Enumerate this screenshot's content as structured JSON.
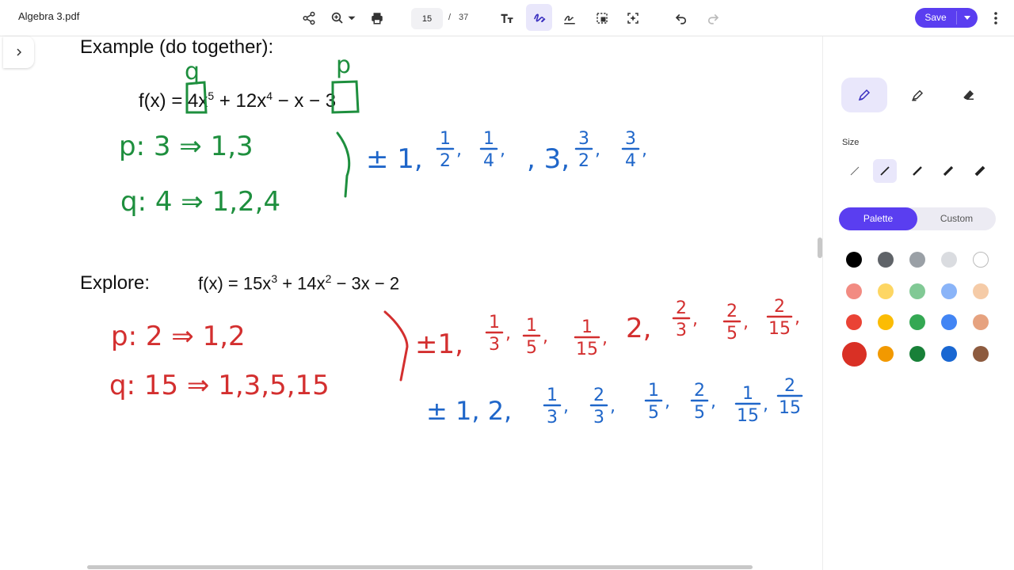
{
  "app": {
    "file_name": "Algebra 3.pdf",
    "page_current": "15",
    "page_separator": "/",
    "page_total": "37",
    "save_label": "Save"
  },
  "toolbar_icons": [
    "share-icon",
    "zoom-in-icon",
    "zoom-caret-icon",
    "print-icon",
    "text-tool-icon",
    "draw-tool-icon",
    "sign-icon",
    "select-area-icon",
    "ai-assist-icon",
    "undo-icon",
    "redo-icon",
    "more-icon"
  ],
  "document": {
    "example_heading": "Example (do together):",
    "example_eq": {
      "prefix": "f(x) =",
      "c1": "4",
      "t1": "x",
      "e1": "5",
      "mid": " + 12x",
      "e2": "4",
      "suffix": " − x − ",
      "c_last": "3"
    },
    "explore_heading": "Explore:",
    "explore_eq": {
      "prefix": "f(x) = 15x",
      "e1": "3",
      "mid": " + 14x",
      "e2": "2",
      "suffix": " − 3x − 2"
    },
    "ink": {
      "q_label": "q",
      "p_label": "p",
      "p_line_1": "p: 3 ⇒ 1,3",
      "q_line_1": "q: 4 ⇒ 1,2,4",
      "list_1": "± 1,",
      "list_1_end": ", 3,",
      "frac_1": [
        {
          "n": "1",
          "d": "2"
        },
        {
          "n": "1",
          "d": "4"
        }
      ],
      "frac_1b": [
        {
          "n": "3",
          "d": "2"
        },
        {
          "n": "3",
          "d": "4"
        }
      ],
      "p_line_2": "p: 2 ⇒ 1,2",
      "q_line_2": "q: 15 ⇒ 1,3,5,15",
      "list_2": "±1,",
      "list_2_mid": "2,",
      "frac_2": [
        {
          "n": "1",
          "d": "3"
        },
        {
          "n": "1",
          "d": "5"
        },
        {
          "n": "1",
          "d": "15"
        }
      ],
      "frac_2b": [
        {
          "n": "2",
          "d": "3"
        },
        {
          "n": "2",
          "d": "5"
        },
        {
          "n": "2",
          "d": "15"
        }
      ],
      "list_3": "± 1, 2,",
      "frac_3": [
        {
          "n": "1",
          "d": "3"
        },
        {
          "n": "2",
          "d": "3"
        },
        {
          "n": "1",
          "d": "5"
        },
        {
          "n": "2",
          "d": "5"
        },
        {
          "n": "1",
          "d": "15"
        },
        {
          "n": "2",
          "d": "15"
        }
      ]
    }
  },
  "panel": {
    "size_label": "Size",
    "palette_tab": "Palette",
    "custom_tab": "Custom",
    "colors": {
      "green_ink": "#1e8f3e",
      "blue_ink": "#1f66c9",
      "red_ink": "#d32f2f",
      "accent": "#5a3ef0"
    },
    "swatches": [
      [
        "#000000",
        "#5f6368",
        "#9aa0a6",
        "#dadce0",
        "#ffffff"
      ],
      [
        "#f28b82",
        "#fdd663",
        "#81c995",
        "#8ab4f8",
        "#f5cba7"
      ],
      [
        "#ea4335",
        "#fbbc04",
        "#34a853",
        "#4285f4",
        "#e6a27f"
      ],
      [
        "#d93025",
        "#f29900",
        "#188038",
        "#1967d2",
        "#8d5b3f"
      ]
    ]
  }
}
